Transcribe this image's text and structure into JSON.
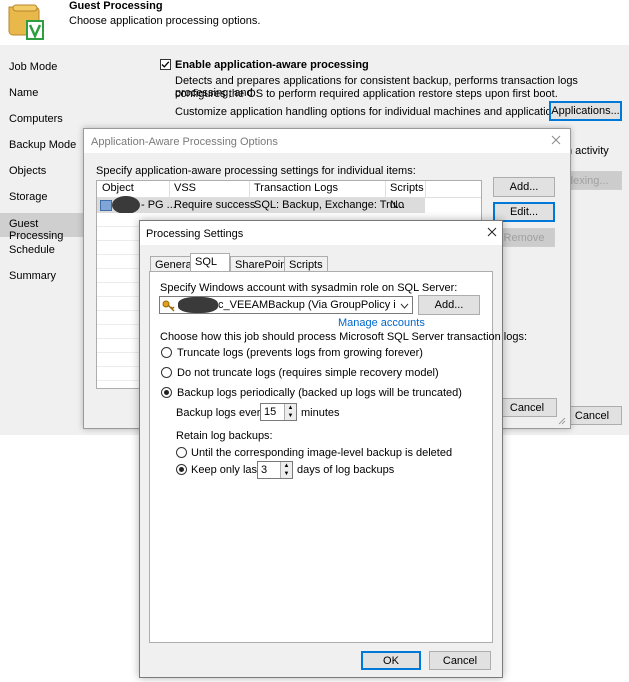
{
  "header": {
    "title": "Guest Processing",
    "subtitle": "Choose application processing options."
  },
  "nav": {
    "items": [
      "Job Mode",
      "Name",
      "Computers",
      "Backup Mode",
      "Objects",
      "Storage",
      "Guest Processing",
      "Schedule",
      "Summary"
    ]
  },
  "main": {
    "enable_label": "Enable application-aware processing",
    "enable_desc_1": "Detects and prepares applications for consistent backup, performs transaction logs processing, and",
    "enable_desc_2": "configures the OS to perform required application restore steps upon first boot.",
    "customize_text": "Customize application handling options for individual machines and applications",
    "applications_button": "Applications...",
    "activity_fragment": "n activity",
    "indexing_fragment": "dexing...",
    "cancel_button": "Cancel"
  },
  "aap": {
    "title": "Application-Aware Processing Options",
    "instruction": "Specify application-aware processing settings for individual items:",
    "columns": [
      "Object",
      "VSS",
      "Transaction Logs",
      "Scripts"
    ],
    "row": {
      "object": "- PG ...",
      "vss": "Require success",
      "logs": "SQL: Backup, Exchange: Tru...",
      "scripts": "No"
    },
    "add_button": "Add...",
    "edit_button": "Edit...",
    "remove_button": "Remove",
    "cancel_button": "Cancel"
  },
  "ps": {
    "title": "Processing Settings",
    "tabs": [
      "General",
      "SQL",
      "SharePoint",
      "Scripts"
    ],
    "account_label": "Specify Windows account with sysadmin role on SQL Server:",
    "account_value": "c_VEEAMBackup (Via GroupPolicy is dit acc",
    "add_button": "Add...",
    "manage_link": "Manage accounts",
    "choose_label": "Choose how this job should process Microsoft SQL Server transaction logs:",
    "opt_truncate": "Truncate logs (prevents logs from growing forever)",
    "opt_no_truncate": "Do not truncate logs (requires simple recovery model)",
    "opt_backup": "Backup logs periodically (backed up logs will be truncated)",
    "every_label": "Backup logs every:",
    "every_value": "15",
    "every_unit": "minutes",
    "retain_label": "Retain log backups:",
    "opt_until": "Until the corresponding image-level backup is deleted",
    "opt_keep": "Keep only last",
    "keep_value": "3",
    "keep_unit": "days of log backups",
    "ok_button": "OK",
    "cancel_button": "Cancel"
  },
  "colors": {
    "accent": "#0078d7",
    "link": "#0066cc",
    "nav_selected": "#cfcfcf",
    "panel": "#f0f0f0"
  }
}
